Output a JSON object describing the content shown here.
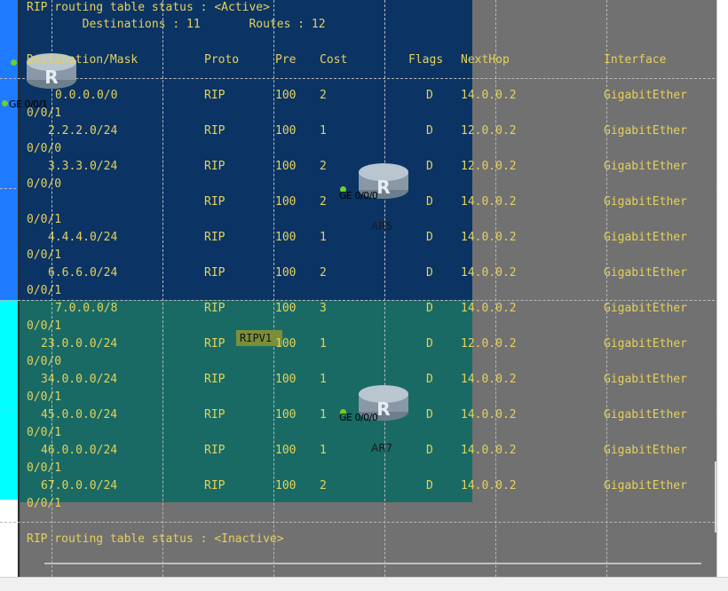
{
  "terminal": {
    "active_header": "RIP routing table status : <Active>",
    "summary": "        Destinations : 11       Routes : 12",
    "columns": [
      "Destination/Mask",
      "Proto",
      "Pre",
      "Cost",
      "Flags",
      "NextHop",
      "Interface"
    ],
    "rows": [
      {
        "dest": "0.0.0.0/0",
        "proto": "RIP",
        "pre": "100",
        "cost": "2",
        "flags": "D",
        "nexthop": "14.0.0.2",
        "iface": "GigabitEther",
        "wrap": "0/0/1"
      },
      {
        "dest": "2.2.2.0/24",
        "proto": "RIP",
        "pre": "100",
        "cost": "1",
        "flags": "D",
        "nexthop": "12.0.0.2",
        "iface": "GigabitEther",
        "wrap": "0/0/0"
      },
      {
        "dest": "3.3.3.0/24",
        "proto": "RIP",
        "pre": "100",
        "cost": "2",
        "flags": "D",
        "nexthop": "12.0.0.2",
        "iface": "GigabitEther",
        "wrap": "0/0/0"
      },
      {
        "dest": "",
        "proto": "RIP",
        "pre": "100",
        "cost": "2",
        "flags": "D",
        "nexthop": "14.0.0.2",
        "iface": "GigabitEther",
        "wrap": "0/0/1"
      },
      {
        "dest": "4.4.4.0/24",
        "proto": "RIP",
        "pre": "100",
        "cost": "1",
        "flags": "D",
        "nexthop": "14.0.0.2",
        "iface": "GigabitEther",
        "wrap": "0/0/1"
      },
      {
        "dest": "6.6.6.0/24",
        "proto": "RIP",
        "pre": "100",
        "cost": "2",
        "flags": "D",
        "nexthop": "14.0.0.2",
        "iface": "GigabitEther",
        "wrap": "0/0/1"
      },
      {
        "dest": "7.0.0.0/8",
        "proto": "RIP",
        "pre": "100",
        "cost": "3",
        "flags": "D",
        "nexthop": "14.0.0.2",
        "iface": "GigabitEther",
        "wrap": "0/0/1"
      },
      {
        "dest": "23.0.0.0/24",
        "proto": "RIP",
        "pre": "100",
        "cost": "1",
        "flags": "D",
        "nexthop": "12.0.0.2",
        "iface": "GigabitEther",
        "wrap": "0/0/0"
      },
      {
        "dest": "34.0.0.0/24",
        "proto": "RIP",
        "pre": "100",
        "cost": "1",
        "flags": "D",
        "nexthop": "14.0.0.2",
        "iface": "GigabitEther",
        "wrap": "0/0/1"
      },
      {
        "dest": "45.0.0.0/24",
        "proto": "RIP",
        "pre": "100",
        "cost": "1",
        "flags": "D",
        "nexthop": "14.0.0.2",
        "iface": "GigabitEther",
        "wrap": "0/0/1"
      },
      {
        "dest": "46.0.0.0/24",
        "proto": "RIP",
        "pre": "100",
        "cost": "1",
        "flags": "D",
        "nexthop": "14.0.0.2",
        "iface": "GigabitEther",
        "wrap": "0/0/1"
      },
      {
        "dest": "67.0.0.0/24",
        "proto": "RIP",
        "pre": "100",
        "cost": "2",
        "flags": "D",
        "nexthop": "14.0.0.2",
        "iface": "GigabitEther",
        "wrap": "0/0/1"
      }
    ],
    "inactive_header": "RIP routing table status : <Inactive>"
  },
  "topology": {
    "routers": [
      {
        "name": "",
        "icon": "router-icon"
      },
      {
        "name": "AR5",
        "icon": "router-icon"
      },
      {
        "name": "AR7",
        "icon": "router-icon"
      }
    ],
    "ports": [
      "GE 0/0/1",
      "GE 0/0/0",
      "GE 0/0/0"
    ],
    "area_label": "RIPV1"
  },
  "colors": {
    "text": "#e6d15a",
    "terminal_bg": "#696969",
    "zone_blue": "#003366",
    "zone_teal": "#1b6b6b",
    "cyan": "#00ffff"
  }
}
